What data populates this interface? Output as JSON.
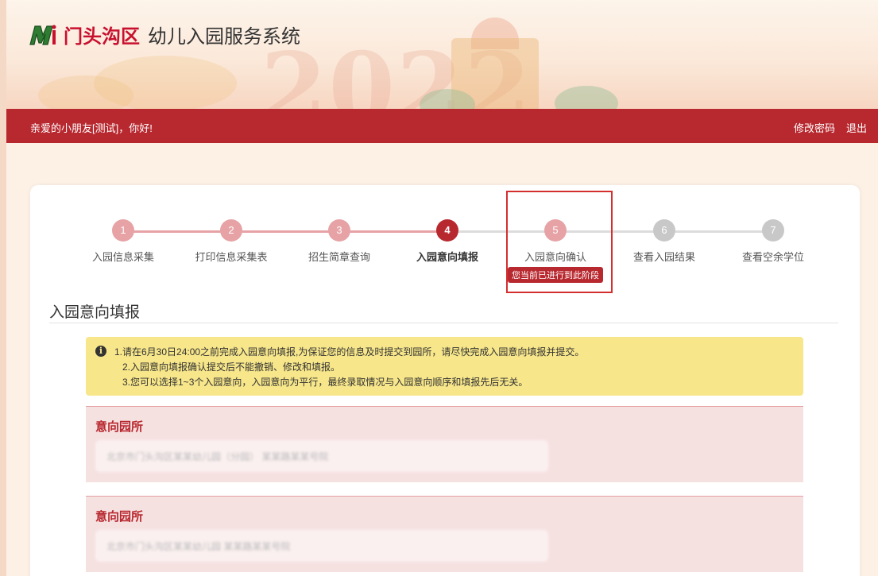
{
  "header": {
    "logo_mark": "M",
    "district": "门头沟区",
    "system_title": "幼儿入园服务系统",
    "banner_year": "2022"
  },
  "navbar": {
    "greeting": "亲爱的小朋友[测试]，你好!",
    "change_password": "修改密码",
    "logout": "退出"
  },
  "steps": [
    {
      "num": "1",
      "label": "入园信息采集",
      "state": "done"
    },
    {
      "num": "2",
      "label": "打印信息采集表",
      "state": "done"
    },
    {
      "num": "3",
      "label": "招生简章查询",
      "state": "done"
    },
    {
      "num": "4",
      "label": "入园意向填报",
      "state": "current"
    },
    {
      "num": "5",
      "label": "入园意向确认",
      "state": "reached",
      "tag": "您当前已进行到此阶段"
    },
    {
      "num": "6",
      "label": "查看入园结果",
      "state": "todo"
    },
    {
      "num": "7",
      "label": "查看空余学位",
      "state": "todo"
    }
  ],
  "section": {
    "title": "入园意向填报"
  },
  "notice": {
    "line1": "1.请在6月30日24:00之前完成入园意向填报,为保证您的信息及时提交到园所，请尽快完成入园意向填报并提交。",
    "line2": "2.入园意向填报确认提交后不能撤销、修改和填报。",
    "line3": "3.您可以选择1~3个入园意向，入园意向为平行，最终录取情况与入园意向顺序和填报先后无关。"
  },
  "intentions": [
    {
      "title": "意向园所",
      "value": "北京市门头沟区某某幼儿园（分园）  某某路某某号院"
    },
    {
      "title": "意向园所",
      "value": "北京市门头沟区某某幼儿园  某某路某某号院"
    }
  ],
  "colors": {
    "brand_red": "#b8282f",
    "step_done": "#e6a2a5",
    "step_todo": "#c8c8c8",
    "notice_bg": "#f7e68a"
  }
}
